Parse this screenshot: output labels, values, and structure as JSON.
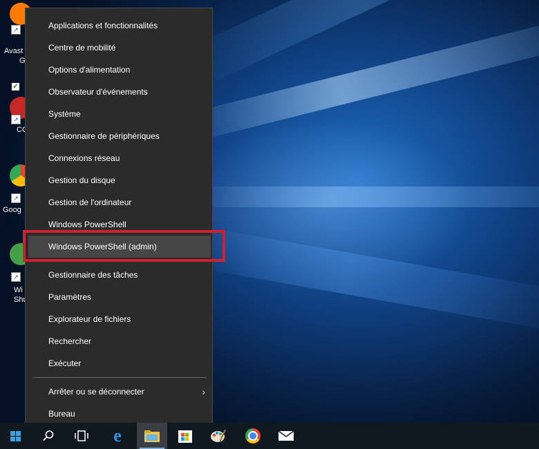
{
  "desktop": {
    "icons": [
      {
        "name": "avast-icon",
        "label_line1": "Avast",
        "label_line2": "G",
        "color": "#ff7a00"
      },
      {
        "name": "ccleaner-icon",
        "label_line1": "CC",
        "color": "#c62828"
      },
      {
        "name": "google-chrome-icon",
        "label_line1": "Goog",
        "color": "#34a853"
      },
      {
        "name": "windows-shutdown-icon",
        "label_line1": "Wi",
        "label_line2": "Shu",
        "color": "#43a047"
      }
    ]
  },
  "menu": {
    "items": [
      {
        "label": "Applications et fonctionnalités"
      },
      {
        "label": "Centre de mobilité"
      },
      {
        "label": "Options d'alimentation"
      },
      {
        "label": "Observateur d'événements"
      },
      {
        "label": "Système"
      },
      {
        "label": "Gestionnaire de périphériques"
      },
      {
        "label": "Connexions réseau"
      },
      {
        "label": "Gestion du disque"
      },
      {
        "label": "Gestion de l'ordinateur"
      },
      {
        "label": "Windows PowerShell"
      },
      {
        "label": "Windows PowerShell (admin)"
      },
      {
        "label": "Gestionnaire des tâches"
      },
      {
        "label": "Paramètres"
      },
      {
        "label": "Explorateur de fichiers"
      },
      {
        "label": "Rechercher"
      },
      {
        "label": "Exécuter"
      },
      {
        "label": "Arrêter ou se déconnecter"
      },
      {
        "label": "Bureau"
      }
    ],
    "highlight_color": "#d1202f"
  },
  "taskbar": {
    "buttons": [
      {
        "name": "start-icon"
      },
      {
        "name": "search-icon"
      },
      {
        "name": "task-view-icon"
      },
      {
        "name": "edge-icon"
      },
      {
        "name": "file-explorer-icon"
      },
      {
        "name": "store-icon"
      },
      {
        "name": "paint-icon"
      },
      {
        "name": "chrome-icon"
      },
      {
        "name": "mail-icon"
      }
    ]
  }
}
